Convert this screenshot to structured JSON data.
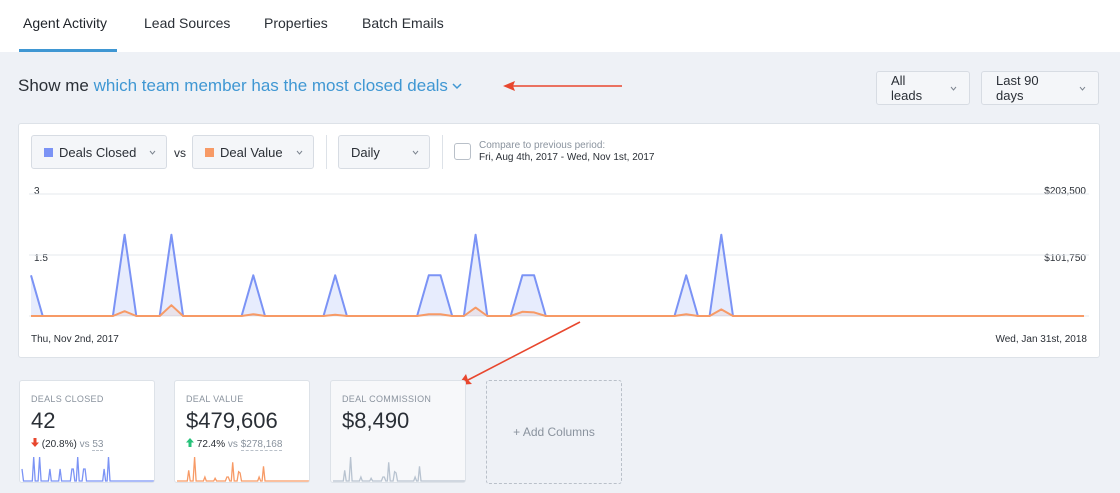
{
  "tabs": [
    {
      "label": "Agent Activity",
      "active": true
    },
    {
      "label": "Lead Sources",
      "active": false
    },
    {
      "label": "Properties",
      "active": false
    },
    {
      "label": "Batch Emails",
      "active": false
    }
  ],
  "question": {
    "prefix": "Show me",
    "metric": "which team member has the most closed deals"
  },
  "filters": {
    "leads": "All leads",
    "period": "Last 90 days"
  },
  "controls": {
    "series1": "Deals Closed",
    "vs": "vs",
    "series2": "Deal Value",
    "granularity": "Daily",
    "compare_label": "Compare to previous period:",
    "compare_range": "Fri, Aug 4th, 2017 - Wed, Nov 1st, 2017"
  },
  "colors": {
    "deals": "#7b93f5",
    "value": "#f79a66",
    "commission": "#b8c3d0",
    "accent": "#3f97d3",
    "arrow": "#e8472e"
  },
  "chart_data": {
    "type": "line",
    "x_start": "Thu, Nov 2nd, 2017",
    "x_end": "Wed, Jan 31st, 2018",
    "y_left_ticks": [
      "3",
      "1.5"
    ],
    "y_right_ticks": [
      "$203,500",
      "$101,750"
    ],
    "ylim_left": [
      0,
      3
    ],
    "ylim_right": [
      0,
      203500
    ],
    "n_days": 91,
    "series": [
      {
        "name": "Deals Closed",
        "axis": "left",
        "values": [
          1,
          0,
          0,
          0,
          0,
          0,
          0,
          0,
          2,
          0,
          0,
          0,
          2,
          0,
          0,
          0,
          0,
          0,
          0,
          1,
          0,
          0,
          0,
          0,
          0,
          0,
          1,
          0,
          0,
          0,
          0,
          0,
          0,
          0,
          1,
          1,
          0,
          0,
          2,
          0,
          0,
          0,
          1,
          1,
          0,
          0,
          0,
          0,
          0,
          0,
          0,
          0,
          0,
          0,
          0,
          0,
          1,
          0,
          0,
          2,
          0,
          0,
          0,
          0,
          0,
          0,
          0,
          0,
          0,
          0,
          0,
          0,
          0,
          0,
          0,
          0,
          0,
          0,
          0,
          0,
          0,
          0,
          0,
          0,
          0,
          0,
          0,
          0,
          0,
          0,
          0
        ]
      },
      {
        "name": "Deal Value",
        "axis": "right",
        "values": [
          0,
          0,
          0,
          0,
          0,
          0,
          0,
          0,
          8000,
          0,
          0,
          0,
          18000,
          0,
          0,
          0,
          0,
          0,
          0,
          3000,
          0,
          0,
          0,
          0,
          0,
          0,
          2000,
          0,
          0,
          0,
          0,
          0,
          0,
          0,
          3000,
          3000,
          0,
          0,
          14000,
          0,
          0,
          0,
          7000,
          6000,
          0,
          0,
          0,
          0,
          0,
          0,
          0,
          0,
          0,
          0,
          0,
          0,
          3000,
          0,
          0,
          11000,
          0,
          0,
          0,
          0,
          0,
          0,
          0,
          0,
          0,
          0,
          0,
          0,
          0,
          0,
          0,
          0,
          0,
          0,
          0,
          0,
          0,
          0,
          0,
          0,
          0,
          0,
          0,
          0,
          0,
          0,
          0
        ]
      }
    ]
  },
  "stats": [
    {
      "title": "DEALS CLOSED",
      "value": "42",
      "change": "(20.8%)",
      "vs": "vs",
      "prev": "53"
    },
    {
      "title": "DEAL VALUE",
      "value": "$479,606",
      "change": "72.4%",
      "vs": "vs",
      "prev": "$278,168"
    },
    {
      "title": "DEAL COMMISSION",
      "value": "$8,490"
    }
  ],
  "add_columns": "+ Add Columns"
}
